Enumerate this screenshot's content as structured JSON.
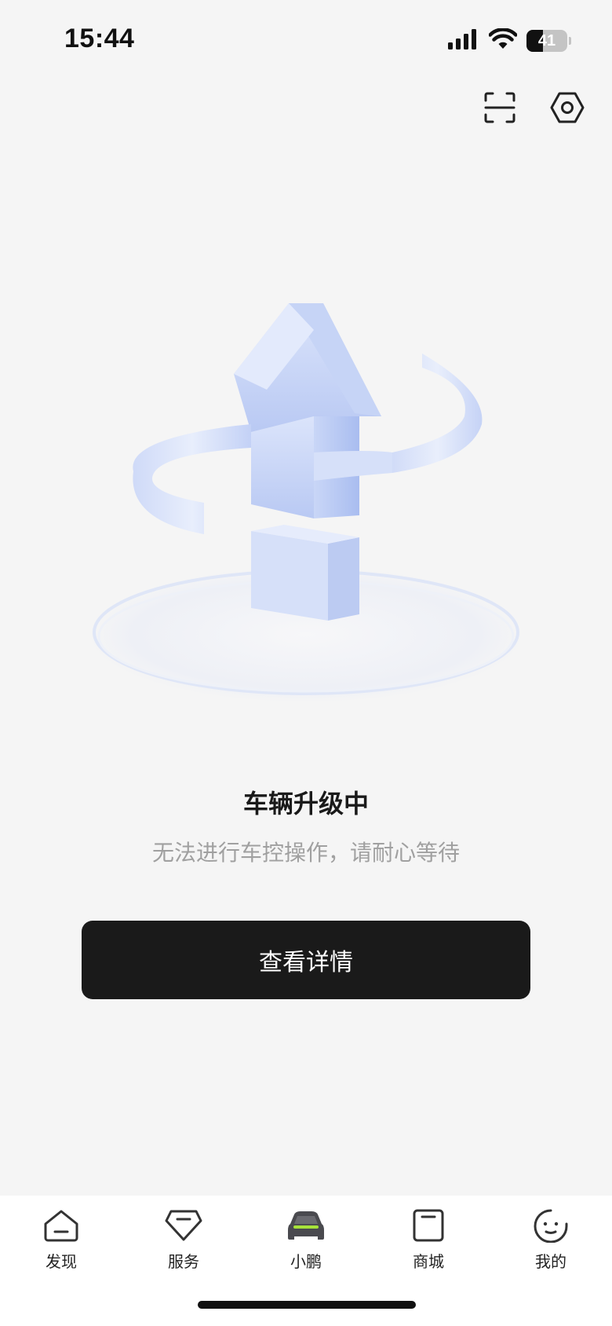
{
  "status_bar": {
    "time": "15:44",
    "battery_level": "41",
    "icons": [
      "signal-icon",
      "wifi-icon",
      "battery-icon"
    ]
  },
  "top_actions": {
    "icons": [
      "scan-icon",
      "settings-icon"
    ]
  },
  "main": {
    "title": "车辆升级中",
    "subtitle": "无法进行车控操作，请耐心等待",
    "button_label": "查看详情"
  },
  "tabbar": {
    "active_index": 2,
    "active_color": "#a7e23a",
    "tabs": [
      {
        "label": "发现",
        "icon": "discover-icon"
      },
      {
        "label": "服务",
        "icon": "service-icon"
      },
      {
        "label": "小鹏",
        "icon": "car-icon"
      },
      {
        "label": "商城",
        "icon": "store-icon"
      },
      {
        "label": "我的",
        "icon": "profile-icon"
      }
    ]
  }
}
